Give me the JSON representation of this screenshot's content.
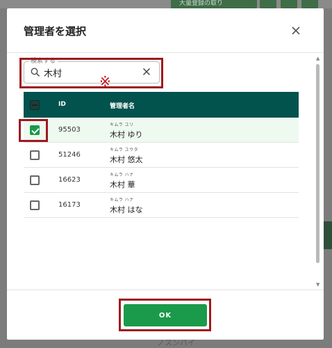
{
  "background": {
    "top_pill_text": "大量登録の取り",
    "bottom_text": "ノスンバイ"
  },
  "dialog": {
    "title": "管理者を選択",
    "close_icon": "close-icon"
  },
  "search": {
    "legend": "検索する",
    "value": "木村",
    "icon": "search-icon",
    "clear_icon": "clear-icon"
  },
  "annotation": {
    "mark": "※",
    "color": "#c0111c",
    "box_color": "#9e1a1f"
  },
  "table": {
    "header": {
      "check_icon": "select-all-checkbox-icon",
      "id_label": "ID",
      "name_label": "管理者名"
    },
    "rows": [
      {
        "checked": true,
        "id": "95503",
        "kana": "キムラ ユリ",
        "name": "木村 ゆり"
      },
      {
        "checked": false,
        "id": "51246",
        "kana": "キムラ ユウタ",
        "name": "木村 悠太"
      },
      {
        "checked": false,
        "id": "16623",
        "kana": "キムラ ハナ",
        "name": "木村 華"
      },
      {
        "checked": false,
        "id": "16173",
        "kana": "キムラ ハナ",
        "name": "木村 はな"
      }
    ]
  },
  "footer": {
    "ok_label": "OK"
  },
  "colors": {
    "header_bg": "#02524d",
    "primary": "#1a9a4a",
    "selected_row_bg": "#eef9ef"
  }
}
